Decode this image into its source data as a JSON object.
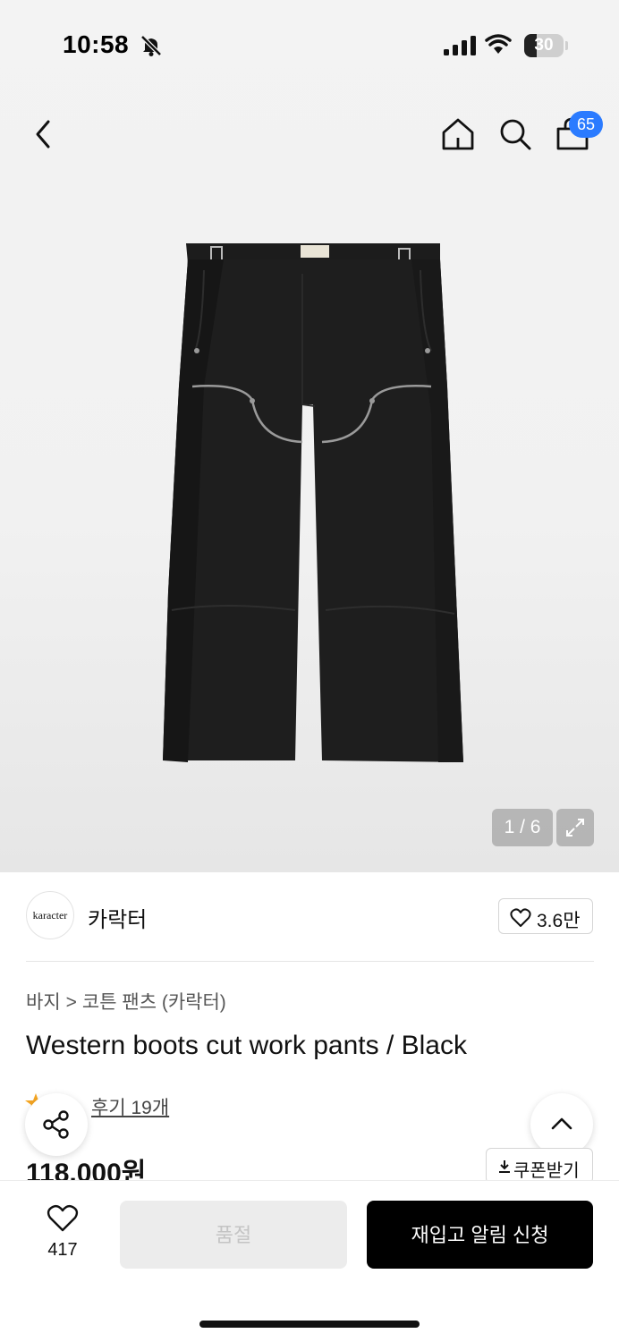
{
  "status_bar": {
    "time": "10:58",
    "battery": "30"
  },
  "header": {
    "cart_count": "65"
  },
  "gallery": {
    "counter": "1 / 6"
  },
  "brand": {
    "logo_text": "karacter",
    "name": "카락터",
    "likes": "3.6만"
  },
  "product": {
    "breadcrumb": [
      "바지",
      "코튼 팬츠 (카락터)"
    ],
    "breadcrumb_separator": ">",
    "title": "Western boots cut work pants / Black",
    "reviews": "후기 19개",
    "price": "118,000원",
    "coupon_label": "쿠폰받기"
  },
  "bottom_bar": {
    "wish_count": "417",
    "soldout_label": "품절",
    "restock_label": "재입고 알림 신청"
  },
  "colors": {
    "badge": "#2b7bff",
    "primary_button": "#000000",
    "disabled_button": "#ececec",
    "rating_star": "#f5a623"
  },
  "icons": [
    "bell-off-icon",
    "signal-icon",
    "wifi-icon",
    "battery-icon",
    "back-arrow-icon",
    "home-icon",
    "search-icon",
    "cart-icon",
    "expand-icon",
    "heart-icon",
    "star-icon",
    "share-icon",
    "chevron-up-icon",
    "download-icon"
  ]
}
